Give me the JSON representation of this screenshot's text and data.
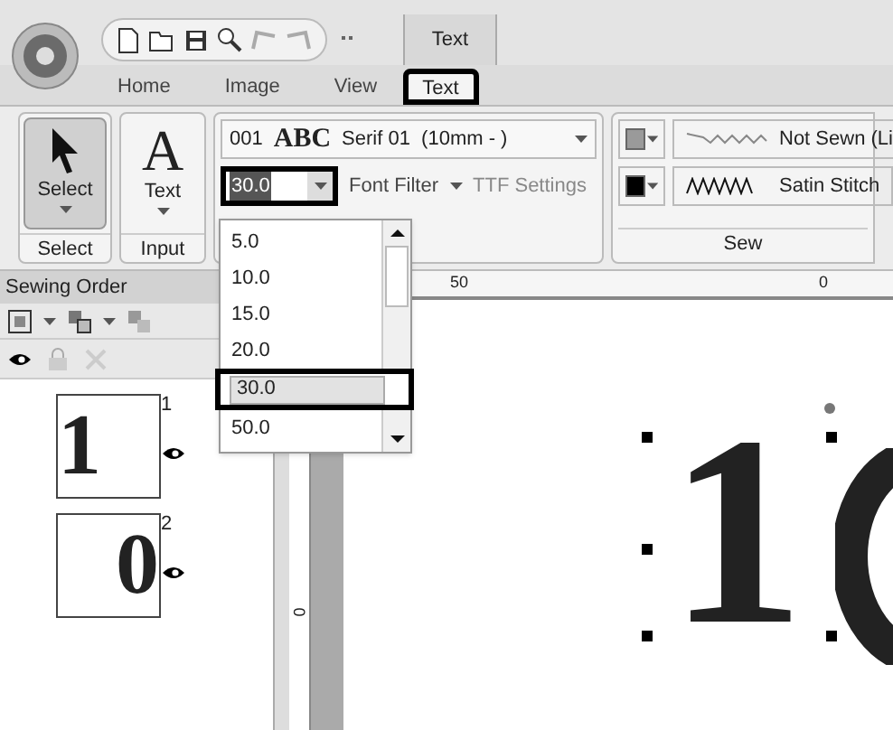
{
  "context_tab": "Text",
  "tabs": [
    {
      "label": "Home",
      "selected": false
    },
    {
      "label": "Image",
      "selected": false
    },
    {
      "label": "View",
      "selected": false
    },
    {
      "label": "Text",
      "selected": true
    }
  ],
  "select_group": {
    "button": "Select",
    "label": "Select"
  },
  "input_group": {
    "icon_letter": "A",
    "button": "Text",
    "group_label": "Input"
  },
  "font": {
    "number": "001",
    "sample": "ABC",
    "name": "Serif 01  (10mm - )",
    "size": "30.0",
    "filter": "Font Filter",
    "ttf": "TTF Settings"
  },
  "sew": {
    "rows": [
      {
        "stitch": "Not Sewn (Li",
        "color": "#9a9a9a"
      },
      {
        "stitch": "Satin Stitch",
        "color": "#000000"
      }
    ],
    "label": "Sew"
  },
  "size_list": [
    {
      "label": "5.0",
      "selected": false
    },
    {
      "label": "10.0",
      "selected": false
    },
    {
      "label": "15.0",
      "selected": false
    },
    {
      "label": "20.0",
      "selected": false
    },
    {
      "label": "30.0",
      "selected": true
    },
    {
      "label": "50.0",
      "selected": false
    }
  ],
  "sewing_order": {
    "title": "Sewing Order",
    "items": [
      {
        "number": "1",
        "glyph": "1",
        "visible": true
      },
      {
        "number": "2",
        "glyph": "0",
        "visible": true
      }
    ]
  },
  "ruler": {
    "h_labels": [
      "50",
      "0"
    ],
    "v_label": "0"
  },
  "design_text": "1"
}
